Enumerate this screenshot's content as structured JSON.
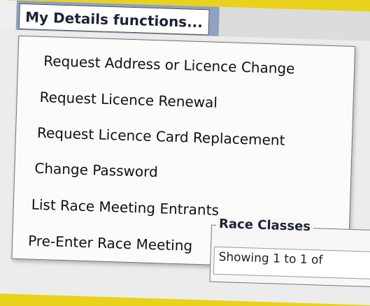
{
  "menu": {
    "title": "My Details functions...",
    "items": [
      "Request Address or Licence Change",
      "Request Licence Renewal",
      "Request Licence Card Replacement",
      "Change Password",
      "List Race Meeting Entrants",
      "Pre-Enter Race Meeting"
    ]
  },
  "race_classes": {
    "legend": "Race Classes",
    "showing_text": "Showing 1 to 1 of"
  },
  "colors": {
    "background_frame": "#e9d21b",
    "menubar": "#8ea2c4"
  }
}
